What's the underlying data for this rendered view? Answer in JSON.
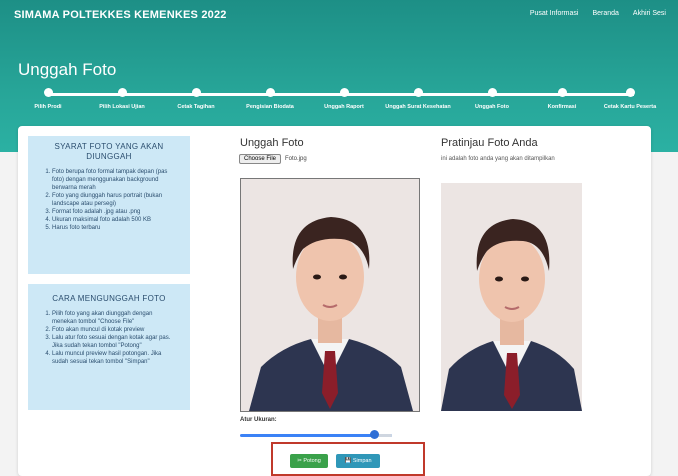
{
  "header": {
    "brand": "SIMAMA POLTEKKES KEMENKES 2022",
    "nav": [
      "Pusat Informasi",
      "Beranda",
      "Akhiri Sesi"
    ]
  },
  "page_title": "Unggah Foto",
  "steps": [
    {
      "label": "Pilih Prodi"
    },
    {
      "label": "Pilih Lokasi Ujian"
    },
    {
      "label": "Cetak Tagihan"
    },
    {
      "label": "Pengisian Biodata"
    },
    {
      "label": "Unggah Raport"
    },
    {
      "label": "Unggah Surat Kesehatan"
    },
    {
      "label": "Unggah Foto"
    },
    {
      "label": "Konfirmasi"
    },
    {
      "label": "Cetak Kartu Peserta"
    }
  ],
  "requirements": {
    "title": "SYARAT FOTO YANG AKAN DIUNGGAH",
    "items": [
      "Foto berupa foto formal tampak depan (pas foto) dengan menggunakan background berwarna merah",
      "Foto yang diunggah harus portrait (bukan landscape atau persegi)",
      "Format foto adalah .jpg atau .png",
      "Ukuran maksimal foto adalah 500 KB",
      "Harus foto terbaru"
    ]
  },
  "howto": {
    "title": "CARA MENGUNGGAH FOTO",
    "items": [
      "Pilih foto yang akan diunggah dengan menekan tombol \"Choose File\"",
      "Foto akan muncul di kotak preview",
      "Lalu atur foto sesuai dengan kotak agar pas. Jika sudah tekan tombol \"Potong\"",
      "Lalu muncul preview hasil potongan. Jika sudah sesuai tekan tombol \"Simpan\""
    ]
  },
  "upload": {
    "title": "Unggah Foto",
    "choose_label": "Choose File",
    "file_name": "Foto.jpg",
    "zoom_label": "Atur Ukuran:",
    "zoom_value": 0.88
  },
  "preview": {
    "title": "Pratinjau Foto Anda",
    "subtitle": "ini adalah foto anda yang akan ditampilkan"
  },
  "actions": {
    "crop": "✂ Potong",
    "save": "💾 Simpan"
  },
  "colors": {
    "header": "#27a598",
    "info_box": "#cde8f6",
    "crop_button": "#3aa14a",
    "save_button": "#2f97b8",
    "highlight_border": "#c0392b"
  }
}
